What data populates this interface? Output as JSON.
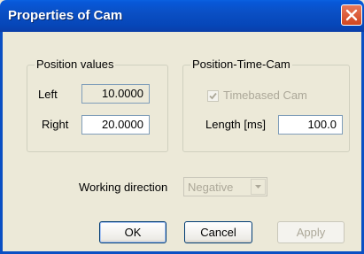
{
  "window": {
    "title": "Properties of Cam"
  },
  "position_values": {
    "group_label": "Position values",
    "left_label": "Left",
    "left_value": "10.0000",
    "right_label": "Right",
    "right_value": "20.0000"
  },
  "position_time_cam": {
    "group_label": "Position-Time-Cam",
    "timebased_label": "Timebased Cam",
    "timebased_checked": true,
    "length_label": "Length [ms]",
    "length_value": "100.0"
  },
  "working_direction": {
    "label": "Working direction",
    "selected": "Negative"
  },
  "buttons": {
    "ok": "OK",
    "cancel": "Cancel",
    "apply": "Apply"
  },
  "colors": {
    "titlebar": "#0a4fc4",
    "close": "#d2461f",
    "dialog_bg": "#ece9d8",
    "disabled_text": "#aca899"
  },
  "icons": {
    "close": "close-icon",
    "check": "check-icon",
    "dropdown": "chevron-down-icon"
  }
}
